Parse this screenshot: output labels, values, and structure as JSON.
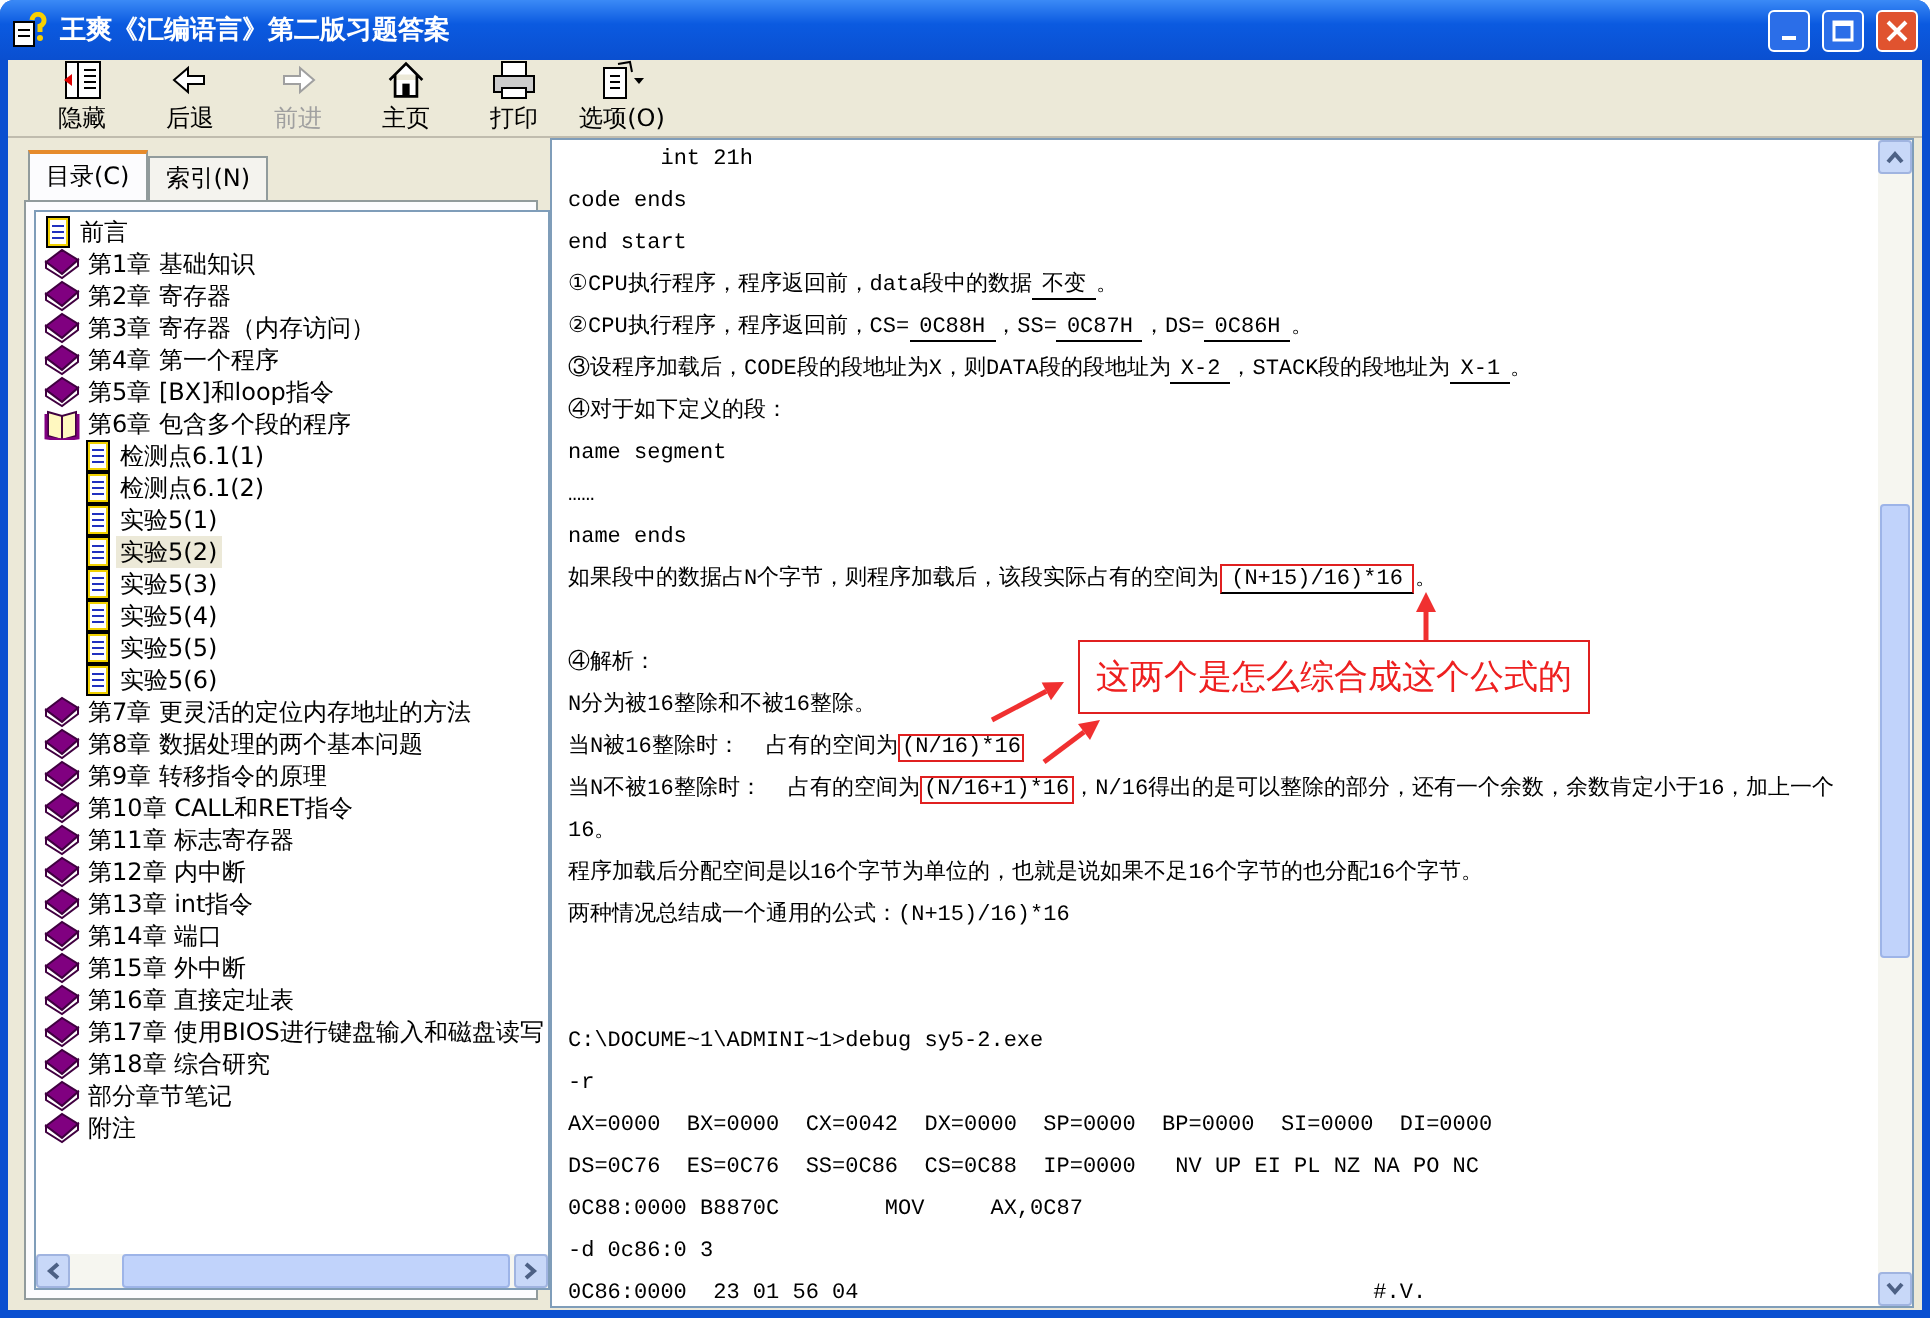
{
  "window": {
    "title": "王爽《汇编语言》第二版习题答案"
  },
  "toolbar": [
    {
      "label": "隐藏",
      "kind": "hide",
      "disabled": false
    },
    {
      "label": "后退",
      "kind": "back",
      "disabled": false
    },
    {
      "label": "前进",
      "kind": "forward",
      "disabled": true
    },
    {
      "label": "主页",
      "kind": "home",
      "disabled": false
    },
    {
      "label": "打印",
      "kind": "print",
      "disabled": false
    },
    {
      "label": "选项(O)",
      "kind": "options",
      "disabled": false
    }
  ],
  "tabs": [
    {
      "label": "目录(C)",
      "selected": true
    },
    {
      "label": "索引(N)",
      "selected": false
    }
  ],
  "tree": [
    {
      "label": "前言",
      "kind": "page",
      "selected": false
    },
    {
      "label": "第1章 基础知识",
      "kind": "book",
      "selected": false
    },
    {
      "label": "第2章 寄存器",
      "kind": "book",
      "selected": false
    },
    {
      "label": "第3章 寄存器（内存访问）",
      "kind": "book",
      "selected": false
    },
    {
      "label": "第4章 第一个程序",
      "kind": "book",
      "selected": false
    },
    {
      "label": "第5章 [BX]和loop指令",
      "kind": "book",
      "selected": false
    },
    {
      "label": "第6章 包含多个段的程序",
      "kind": "open-book",
      "selected": false,
      "children": [
        {
          "label": "检测点6.1(1)",
          "kind": "page",
          "selected": false
        },
        {
          "label": "检测点6.1(2)",
          "kind": "page",
          "selected": false
        },
        {
          "label": "实验5(1)",
          "kind": "page",
          "selected": false
        },
        {
          "label": "实验5(2)",
          "kind": "page",
          "selected": true
        },
        {
          "label": "实验5(3)",
          "kind": "page",
          "selected": false
        },
        {
          "label": "实验5(4)",
          "kind": "page",
          "selected": false
        },
        {
          "label": "实验5(5)",
          "kind": "page",
          "selected": false
        },
        {
          "label": "实验5(6)",
          "kind": "page",
          "selected": false
        }
      ]
    },
    {
      "label": "第7章 更灵活的定位内存地址的方法",
      "kind": "book",
      "selected": false
    },
    {
      "label": "第8章 数据处理的两个基本问题",
      "kind": "book",
      "selected": false
    },
    {
      "label": "第9章 转移指令的原理",
      "kind": "book",
      "selected": false
    },
    {
      "label": "第10章 CALL和RET指令",
      "kind": "book",
      "selected": false
    },
    {
      "label": "第11章 标志寄存器",
      "kind": "book",
      "selected": false
    },
    {
      "label": "第12章 内中断",
      "kind": "book",
      "selected": false
    },
    {
      "label": "第13章 int指令",
      "kind": "book",
      "selected": false
    },
    {
      "label": "第14章 端口",
      "kind": "book",
      "selected": false
    },
    {
      "label": "第15章 外中断",
      "kind": "book",
      "selected": false
    },
    {
      "label": "第16章 直接定址表",
      "kind": "book",
      "selected": false
    },
    {
      "label": "第17章 使用BIOS进行键盘输入和磁盘读写",
      "kind": "book",
      "selected": false
    },
    {
      "label": "第18章 综合研究",
      "kind": "book",
      "selected": false
    },
    {
      "label": "部分章节笔记",
      "kind": "book",
      "selected": false
    },
    {
      "label": "附注",
      "kind": "book",
      "selected": false
    }
  ],
  "content": {
    "lines": [
      {
        "kind": "text",
        "parts": [
          {
            "kind": "plain",
            "text": "       int 21h"
          }
        ]
      },
      {
        "kind": "text",
        "parts": [
          {
            "kind": "plain",
            "text": "code ends"
          }
        ]
      },
      {
        "kind": "text",
        "parts": [
          {
            "kind": "plain",
            "text": "end start"
          }
        ]
      },
      {
        "kind": "text",
        "parts": [
          {
            "kind": "plain",
            "text": "①CPU执行程序，程序返回前，data段中的数据"
          },
          {
            "kind": "blank",
            "text": "不变"
          },
          {
            "kind": "plain",
            "text": "。"
          }
        ]
      },
      {
        "kind": "text",
        "parts": [
          {
            "kind": "plain",
            "text": "②CPU执行程序，程序返回前，CS="
          },
          {
            "kind": "blank",
            "text": "0C88H"
          },
          {
            "kind": "plain",
            "text": "，SS="
          },
          {
            "kind": "blank",
            "text": "0C87H"
          },
          {
            "kind": "plain",
            "text": "，DS="
          },
          {
            "kind": "blank",
            "text": "0C86H"
          },
          {
            "kind": "plain",
            "text": "。"
          }
        ]
      },
      {
        "kind": "text",
        "parts": [
          {
            "kind": "plain",
            "text": "③设程序加载后，CODE段的段地址为X，则DATA段的段地址为"
          },
          {
            "kind": "blank",
            "text": "X-2"
          },
          {
            "kind": "plain",
            "text": "，STACK段的段地址为"
          },
          {
            "kind": "blank",
            "text": "X-1"
          },
          {
            "kind": "plain",
            "text": "。"
          }
        ]
      },
      {
        "kind": "text",
        "parts": [
          {
            "kind": "plain",
            "text": "④对于如下定义的段："
          }
        ]
      },
      {
        "kind": "text",
        "parts": [
          {
            "kind": "plain",
            "text": "name segment"
          }
        ]
      },
      {
        "kind": "text",
        "parts": [
          {
            "kind": "plain",
            "text": "……"
          }
        ]
      },
      {
        "kind": "text",
        "parts": [
          {
            "kind": "plain",
            "text": "name ends"
          }
        ]
      },
      {
        "kind": "text",
        "parts": [
          {
            "kind": "plain",
            "text": "如果段中的数据占N个字节，则程序加载后，该段实际占有的空间为"
          },
          {
            "kind": "boxed-blank",
            "text": "(N+15)/16)*16"
          },
          {
            "kind": "plain",
            "text": "。"
          }
        ]
      },
      {
        "kind": "space"
      },
      {
        "kind": "text",
        "parts": [
          {
            "kind": "plain",
            "text": "④解析："
          }
        ]
      },
      {
        "kind": "text",
        "parts": [
          {
            "kind": "plain",
            "text": "N分为被16整除和不被16整除。"
          }
        ]
      },
      {
        "kind": "text",
        "parts": [
          {
            "kind": "plain",
            "text": "当N被16整除时：  占有的空间为"
          },
          {
            "kind": "boxed",
            "text": "(N/16)*16"
          }
        ]
      },
      {
        "kind": "text",
        "parts": [
          {
            "kind": "plain",
            "text": "当N不被16整除时：  占有的空间为"
          },
          {
            "kind": "boxed",
            "text": "(N/16+1)*16"
          },
          {
            "kind": "plain",
            "text": "，N/16得出的是可以整除的部分，还有一个余数，余数肯定小于16，加上一个16。"
          }
        ]
      },
      {
        "kind": "text",
        "parts": [
          {
            "kind": "plain",
            "text": "程序加载后分配空间是以16个字节为单位的，也就是说如果不足16个字节的也分配16个字节。"
          }
        ]
      },
      {
        "kind": "text",
        "parts": [
          {
            "kind": "plain",
            "text": "两种情况总结成一个通用的公式：(N+15)/16)*16"
          }
        ]
      },
      {
        "kind": "space"
      },
      {
        "kind": "space"
      },
      {
        "kind": "text",
        "parts": [
          {
            "kind": "plain",
            "text": "C:\\DOCUME~1\\ADMINI~1>debug sy5-2.exe"
          }
        ]
      },
      {
        "kind": "text",
        "parts": [
          {
            "kind": "plain",
            "text": "-r"
          }
        ]
      },
      {
        "kind": "text",
        "parts": [
          {
            "kind": "plain",
            "text": "AX=0000  BX=0000  CX=0042  DX=0000  SP=0000  BP=0000  SI=0000  DI=0000"
          }
        ]
      },
      {
        "kind": "text",
        "parts": [
          {
            "kind": "plain",
            "text": "DS=0C76  ES=0C76  SS=0C86  CS=0C88  IP=0000   NV UP EI PL NZ NA PO NC"
          }
        ]
      },
      {
        "kind": "text",
        "parts": [
          {
            "kind": "plain",
            "text": "0C88:0000 B8870C        MOV     AX,0C87"
          }
        ]
      },
      {
        "kind": "text",
        "parts": [
          {
            "kind": "plain",
            "text": "-d 0c86:0 3"
          }
        ]
      },
      {
        "kind": "text",
        "parts": [
          {
            "kind": "plain",
            "text": "0C86:0000  23 01 56 04                                       #.V."
          }
        ]
      }
    ],
    "callout": "这两个是怎么综合成这个公式的"
  }
}
